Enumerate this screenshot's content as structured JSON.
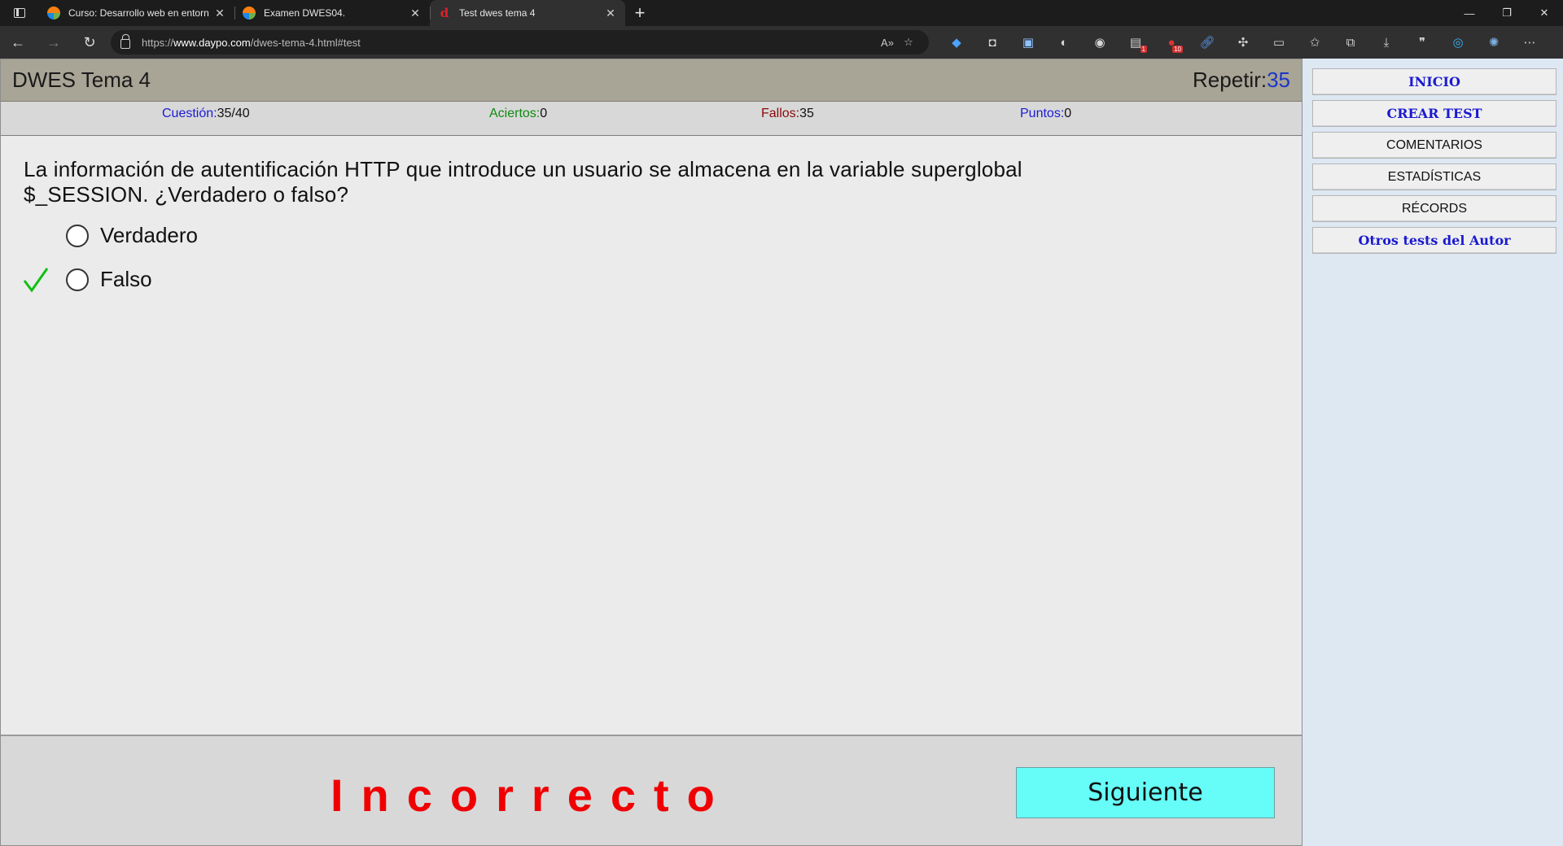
{
  "browser": {
    "tabs": [
      {
        "title": "Curso: Desarrollo web en entorn",
        "favicon": "moodle-icon"
      },
      {
        "title": "Examen DWES04.",
        "favicon": "moodle-icon"
      },
      {
        "title": "Test dwes tema 4",
        "favicon": "daypo-icon"
      }
    ],
    "url_scheme": "https://",
    "url_host": "www.daypo.com",
    "url_path": "/dwes-tema-4.html#test",
    "extension_badges": {
      "ext1": "1",
      "ext2": "10"
    }
  },
  "quiz": {
    "title": "DWES Tema 4",
    "repeat_label": "Repetir:",
    "repeat_value": "35",
    "stats": {
      "cuestion_label": "Cuestión:",
      "cuestion_value": "35/40",
      "aciertos_label": "Aciertos:",
      "aciertos_value": "0",
      "fallos_label": "Fallos:",
      "fallos_value": "35",
      "puntos_label": "Puntos:",
      "puntos_value": "0"
    },
    "question_line1": "La información de autentificación HTTP que introduce un usuario se almacena en la variable superglobal",
    "question_line2": "$_SESSION. ¿Verdadero o falso?",
    "options": [
      "Verdadero",
      "Falso"
    ],
    "correct_option": "Falso",
    "result": "Incorrecto",
    "next_label": "Siguiente"
  },
  "sidebar": {
    "items": [
      "INICIO",
      "CREAR TEST",
      "COMENTARIOS",
      "ESTADÍSTICAS",
      "RÉCORDS",
      "Otros tests del Autor"
    ]
  },
  "colors": {
    "accent_blue": "#1b1bd6",
    "success_green": "#0f8a0f",
    "fail_red": "#8a0a0a",
    "result_red": "#f00000",
    "next_button": "#66fcf8",
    "header_bar": "#a8a496"
  }
}
